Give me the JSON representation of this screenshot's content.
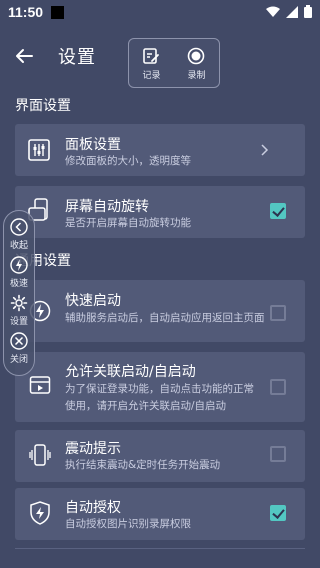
{
  "status": {
    "time": "11:50"
  },
  "header": {
    "title": "设置",
    "tools": [
      {
        "label": "记录",
        "icon": "edit-note-icon"
      },
      {
        "label": "录制",
        "icon": "record-icon"
      }
    ]
  },
  "sections": {
    "ui": "界面设置",
    "general": "通用设置"
  },
  "cards": [
    {
      "title": "面板设置",
      "desc": "修改面板的大小，透明度等",
      "icon": "sliders-icon",
      "control": "chevron"
    },
    {
      "title": "屏幕自动旋转",
      "desc": "是否开启屏幕自动旋转功能",
      "icon": "screen-rotate-icon",
      "control": "checkbox",
      "checked": true
    },
    {
      "title": "快速启动",
      "desc": "辅助服务启动后，自动启动应用返回主页面",
      "icon": "lightning-icon",
      "control": "checkbox",
      "checked": false
    },
    {
      "title": "允许关联启动/自启动",
      "desc": "为了保证登录功能，自动点击功能的正常使用，请开启允许关联启动/自启动",
      "icon": "app-launch-icon",
      "control": "checkbox",
      "checked": false
    },
    {
      "title": "震动提示",
      "desc": "执行结束震动&定时任务开始震动",
      "icon": "vibrate-icon",
      "control": "checkbox",
      "checked": false
    },
    {
      "title": "自动授权",
      "desc": "自动授权图片识别录屏权限",
      "icon": "shield-lightning-icon",
      "control": "checkbox",
      "checked": true
    }
  ],
  "sidebar": [
    {
      "label": "收起",
      "icon": "collapse-icon"
    },
    {
      "label": "极速",
      "icon": "lightning-icon"
    },
    {
      "label": "设置",
      "icon": "gear-icon"
    },
    {
      "label": "关闭",
      "icon": "close-icon"
    }
  ],
  "colors": {
    "background": "#414966",
    "card": "#525a78",
    "accent": "#53c7c2"
  }
}
